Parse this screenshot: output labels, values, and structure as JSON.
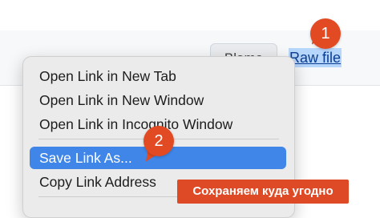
{
  "toolbar": {
    "blame_label": "Blame",
    "raw_file_label": "Raw file"
  },
  "context_menu": {
    "items": [
      {
        "label": "Open Link in New Tab"
      },
      {
        "label": "Open Link in New Window"
      },
      {
        "label": "Open Link in Incognito Window"
      },
      {
        "label": "Save Link As..."
      },
      {
        "label": "Copy Link Address"
      }
    ]
  },
  "annotations": {
    "step1": "1",
    "step2": "2",
    "caption": "Сохраняем куда угодно"
  },
  "colors": {
    "selection": "#3f86e8",
    "badge": "#e14a22",
    "caption_bg": "#de4a26",
    "link_highlight": "#b7d6fb"
  }
}
